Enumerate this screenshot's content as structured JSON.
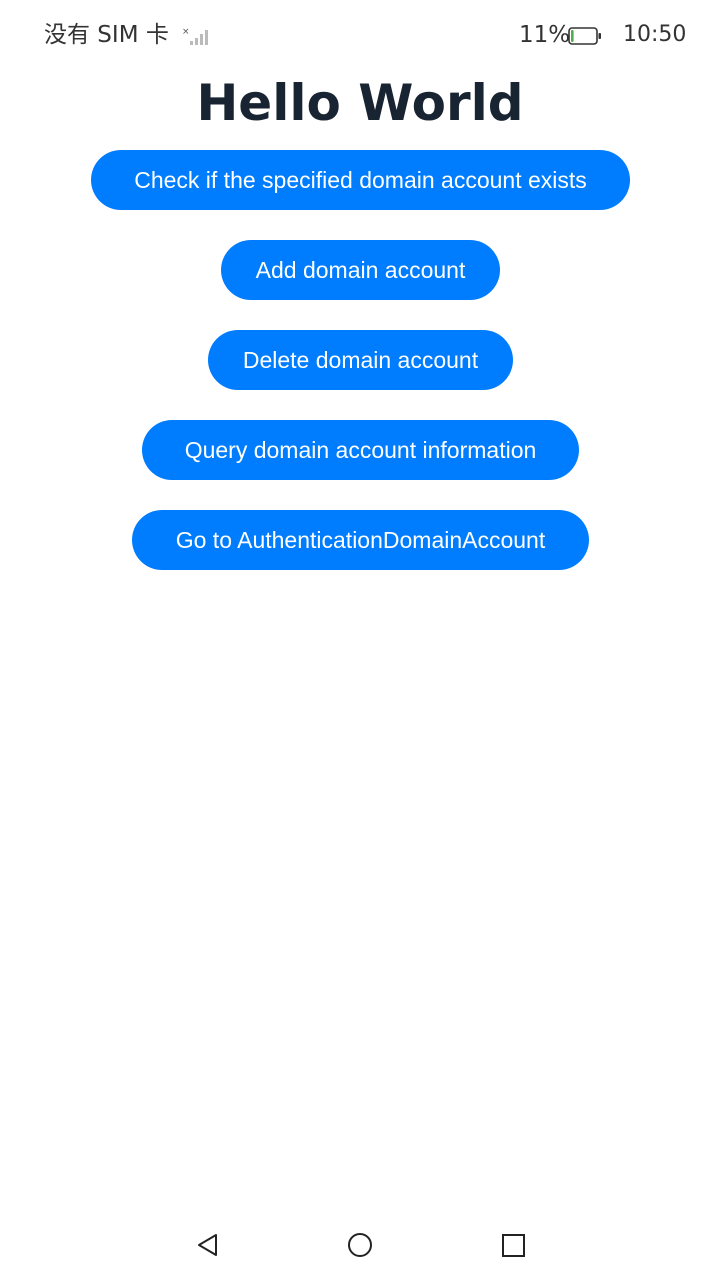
{
  "status_bar": {
    "carrier": "没有 SIM 卡",
    "battery_percent": "11%",
    "battery_level": 0.11,
    "time": "10:50",
    "icons": [
      "no-signal-icon",
      "battery-icon"
    ]
  },
  "main": {
    "title": "Hello World",
    "buttons": [
      {
        "label": "Check if the specified domain account exists"
      },
      {
        "label": "Add domain account"
      },
      {
        "label": "Delete domain account"
      },
      {
        "label": "Query domain account information"
      },
      {
        "label": "Go to AuthenticationDomainAccount"
      }
    ]
  },
  "nav_bar": {
    "icons": [
      "back-icon",
      "home-icon",
      "recent-apps-icon"
    ]
  },
  "colors": {
    "button_bg": "#007dff",
    "button_text": "#ffffff",
    "title": "#182431",
    "status_text": "#333333",
    "battery_fill": "#4caf50"
  }
}
